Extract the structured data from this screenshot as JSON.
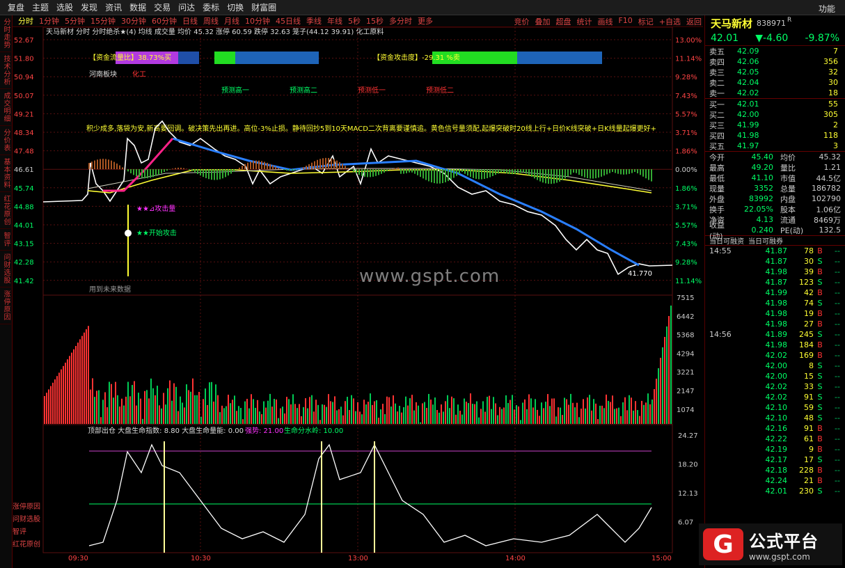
{
  "menu": {
    "items": [
      "复盘",
      "主题",
      "选股",
      "发现",
      "资讯",
      "数据",
      "交易",
      "问达",
      "委标",
      "切换",
      "财富圈"
    ],
    "right": "功能"
  },
  "leftnav": [
    "分时走势",
    "技术分析",
    "成交明细",
    "分价表",
    "基本资料",
    "红花原创",
    "智评",
    "问财选股",
    "涨停原因"
  ],
  "leftbottom": [
    "涨停原因",
    "问财选股",
    "智评",
    "红花原创"
  ],
  "toolbar": {
    "items": [
      "分时",
      "1分钟",
      "5分钟",
      "15分钟",
      "30分钟",
      "60分钟",
      "日线",
      "周线",
      "月线",
      "10分钟",
      "45日线",
      "季线",
      "年线",
      "5秒",
      "15秒",
      "多分时",
      "更多"
    ],
    "right": [
      "竞价",
      "叠加",
      "超盘",
      "统计",
      "画线",
      "F10",
      "标记",
      "+自选",
      "返回"
    ]
  },
  "chart_header": "天马新材  分时  分时绝杀★(4)  均线  成交量  均价 45.32  涨停 60.59  跌停 32.63  笼子(44.12  39.91)  化工原料",
  "price_axis": [
    "52.67",
    "51.80",
    "50.94",
    "50.07",
    "49.21",
    "48.34",
    "47.48",
    "46.61",
    "45.74",
    "44.88",
    "44.01",
    "43.15",
    "42.28",
    "41.42"
  ],
  "pct_axis": [
    "13.00%",
    "11.14%",
    "9.28%",
    "7.43%",
    "5.57%",
    "3.71%",
    "1.86%",
    "0.00%",
    "1.86%",
    "3.71%",
    "5.57%",
    "7.43%",
    "9.28%",
    "11.14%"
  ],
  "vol_axis": [
    "7515",
    "6442",
    "5368",
    "4294",
    "3221",
    "2147",
    "1074"
  ],
  "ind_axis": [
    "24.27",
    "18.20",
    "12.13",
    "6.07"
  ],
  "time_axis": [
    "09:30",
    "10:30",
    "13:00",
    "14:00",
    "15:00"
  ],
  "annotations": {
    "fund_ratio": "【资金流量比】38.73%买",
    "fund_attack": "【资金攻击度】-29.31 %卖",
    "sector": "河南板块",
    "sector_tag": "化工",
    "predict": [
      "预测高一",
      "预测高二",
      "预测低一",
      "预测低二"
    ],
    "note": "积少成多,落袋为安,新高要回调。破决策先出再进。高位-3%止损。静待回抄5到10天MACD二次背离要谨慎追。黄色信号量须配,起爆突破时20线上行+日价K线突破+日K线量起爆更好+",
    "attack1": "★★⊿攻击量",
    "attack2": "★★开始攻击",
    "future": "用到未来数据",
    "low_label": "41.770",
    "ind_header": "顶部出仓  大盘生命指数: 8.80  大盘生命量能: 0.00",
    "ind_strength": "强势: 21.00",
    "ind_water": "生命分水岭: 10.00"
  },
  "quote": {
    "name": "天马新材",
    "code": "838971",
    "badge": "R",
    "price": "42.01",
    "change": "▼-4.60",
    "pct": "-9.87%",
    "asks": [
      [
        "卖五",
        "42.09",
        "7"
      ],
      [
        "卖四",
        "42.06",
        "356"
      ],
      [
        "卖三",
        "42.05",
        "32"
      ],
      [
        "卖二",
        "42.04",
        "30"
      ],
      [
        "卖一",
        "42.02",
        "18"
      ]
    ],
    "bids": [
      [
        "买一",
        "42.01",
        "55"
      ],
      [
        "买二",
        "42.00",
        "305"
      ],
      [
        "买三",
        "41.99",
        "2"
      ],
      [
        "买四",
        "41.98",
        "118"
      ],
      [
        "买五",
        "41.97",
        "3"
      ]
    ],
    "stats": [
      [
        "今开",
        "45.40",
        "均价",
        "45.32"
      ],
      [
        "最高",
        "49.20",
        "量比",
        "1.21"
      ],
      [
        "最低",
        "41.10",
        "市值",
        "44.5亿"
      ],
      [
        "现量",
        "3352",
        "总量",
        "186782"
      ],
      [
        "外盘",
        "83992",
        "内盘",
        "102790"
      ],
      [
        "换手",
        "22.05%",
        "股本",
        "1.06亿"
      ],
      [
        "净资",
        "4.13",
        "流通",
        "8469万"
      ],
      [
        "收益(动)",
        "0.240",
        "PE(动)",
        "132.5"
      ]
    ],
    "tabs": [
      "当日可融资",
      "当日可融券"
    ],
    "ticks": [
      [
        "14:55",
        "41.87",
        "78",
        "B",
        "--"
      ],
      [
        "",
        "41.87",
        "30",
        "S",
        "--"
      ],
      [
        "",
        "41.98",
        "39",
        "B",
        "--"
      ],
      [
        "",
        "41.87",
        "123",
        "S",
        "--"
      ],
      [
        "",
        "41.99",
        "42",
        "B",
        "--"
      ],
      [
        "",
        "41.98",
        "74",
        "S",
        "--"
      ],
      [
        "",
        "41.98",
        "19",
        "B",
        "--"
      ],
      [
        "",
        "41.98",
        "27",
        "B",
        "--"
      ],
      [
        "14:56",
        "41.89",
        "245",
        "S",
        "--"
      ],
      [
        "",
        "41.98",
        "184",
        "B",
        "--"
      ],
      [
        "",
        "42.02",
        "169",
        "B",
        "--"
      ],
      [
        "",
        "42.00",
        "8",
        "S",
        "--"
      ],
      [
        "",
        "42.00",
        "15",
        "S",
        "--"
      ],
      [
        "",
        "42.02",
        "33",
        "S",
        "--"
      ],
      [
        "",
        "42.02",
        "91",
        "S",
        "--"
      ],
      [
        "",
        "42.10",
        "59",
        "S",
        "--"
      ],
      [
        "",
        "42.10",
        "48",
        "S",
        "--"
      ],
      [
        "",
        "42.16",
        "91",
        "B",
        "--"
      ],
      [
        "",
        "42.22",
        "61",
        "B",
        "--"
      ],
      [
        "",
        "42.19",
        "9",
        "B",
        "--"
      ],
      [
        "",
        "42.17",
        "17",
        "S",
        "--"
      ],
      [
        "",
        "42.18",
        "228",
        "B",
        "--"
      ],
      [
        "",
        "42.24",
        "21",
        "B",
        "--"
      ],
      [
        "",
        "42.01",
        "230",
        "S",
        "--"
      ]
    ]
  },
  "watermark": "www.gspt.com",
  "logo": {
    "glyph": "G",
    "title": "公式平台",
    "url": "www.gspt.com"
  },
  "colors": {
    "up": "#ff3333",
    "down": "#00ff66",
    "price_line": "#ffffff",
    "avg_line": "#ffff00",
    "grid": "#5a1010"
  }
}
